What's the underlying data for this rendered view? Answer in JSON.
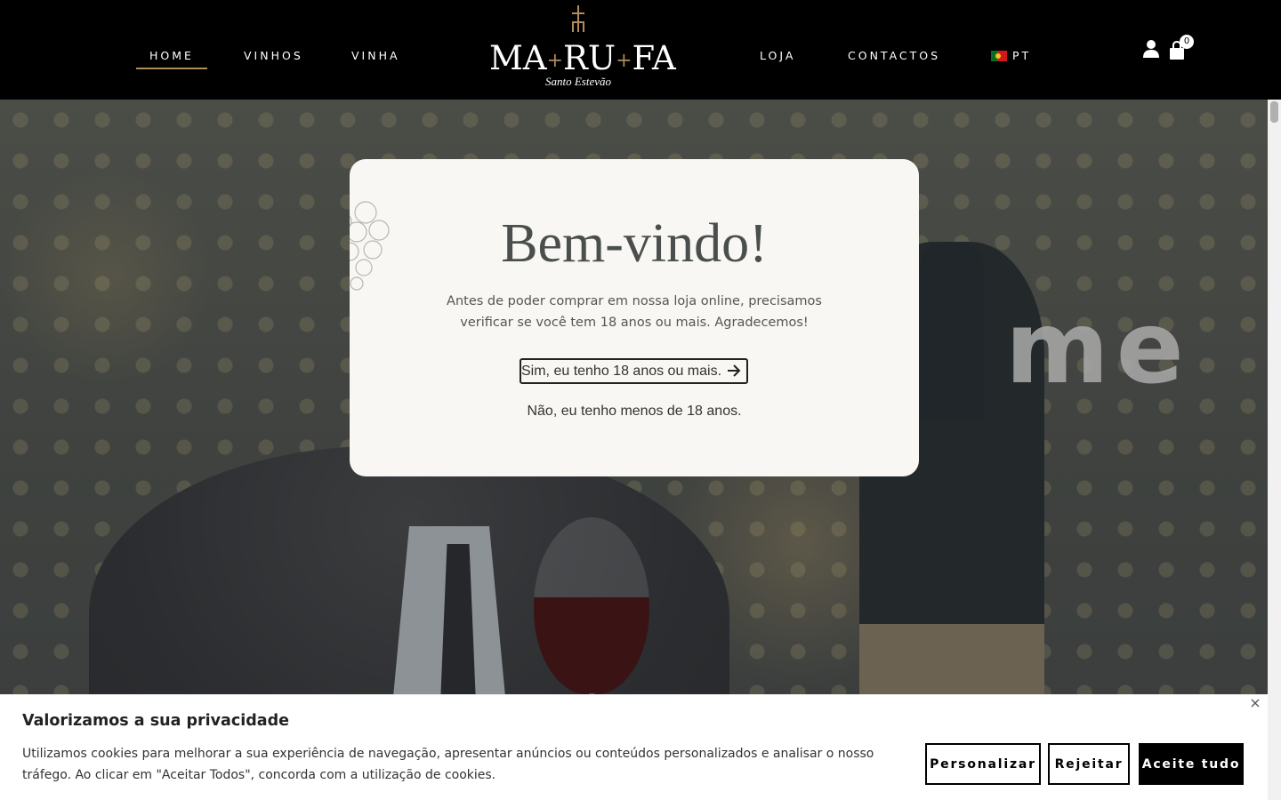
{
  "nav": {
    "home": "HOME",
    "vinhos": "VINHOS",
    "vinha": "VINHA",
    "loja": "LOJA",
    "contactos": "CONTACTOS",
    "lang": "PT"
  },
  "logo": {
    "part1": "MA",
    "part2": "RU",
    "part3": "FA",
    "plus": "+",
    "subtitle": "Santo Estevão"
  },
  "cart": {
    "count": "0"
  },
  "hero": {
    "headline": "me"
  },
  "age_gate": {
    "title": "Bem-vindo!",
    "text": "Antes de poder comprar em nossa loja online, precisamos verificar se você tem 18 anos ou mais. Agradecemos!",
    "yes_label": "Sim, eu tenho 18 anos ou mais.",
    "no_label": "Não, eu tenho menos de 18 anos."
  },
  "cookie": {
    "title": "Valorizamos a sua privacidade",
    "text": "Utilizamos cookies para melhorar a sua experiência de navegação, apresentar anúncios ou conteúdos personalizados e analisar o nosso tráfego. Ao clicar em \"Aceitar Todos\", concorda com a utilização de cookies.",
    "customize": "Personalizar",
    "reject": "Rejeitar",
    "accept": "Aceite tudo"
  },
  "colors": {
    "accent_gold": "#b08d57",
    "header_bg": "#000000",
    "modal_bg": "#f8f7f3"
  }
}
